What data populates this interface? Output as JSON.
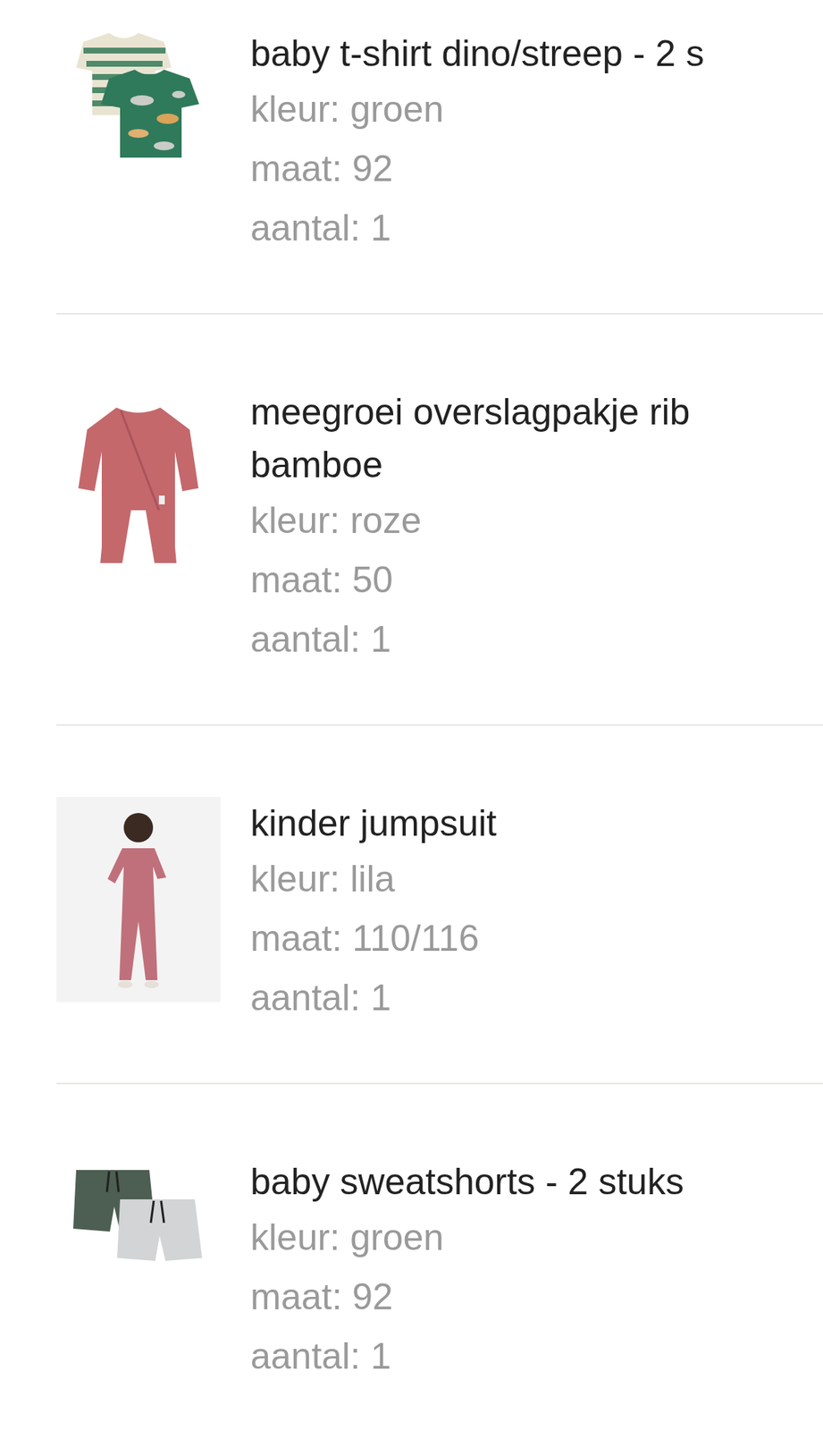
{
  "items": [
    {
      "title": "baby t-shirt dino/streep - 2 s",
      "picture": "tshirts",
      "details": [
        {
          "label": "kleur:",
          "value": "groen"
        },
        {
          "label": "maat:",
          "value": "92"
        },
        {
          "label": "aantal:",
          "value": "1"
        }
      ]
    },
    {
      "title": "meegroei overslagpakje rib bamboe",
      "picture": "onesie",
      "details": [
        {
          "label": "kleur:",
          "value": "roze"
        },
        {
          "label": "maat:",
          "value": "50"
        },
        {
          "label": "aantal:",
          "value": "1"
        }
      ]
    },
    {
      "title": "kinder jumpsuit",
      "picture": "photo",
      "details": [
        {
          "label": "kleur:",
          "value": "lila"
        },
        {
          "label": "maat:",
          "value": "110/116"
        },
        {
          "label": "aantal:",
          "value": "1"
        }
      ]
    },
    {
      "title": "baby sweatshorts - 2 stuks",
      "picture": "shorts",
      "details": [
        {
          "label": "kleur:",
          "value": "groen"
        },
        {
          "label": "maat:",
          "value": "92"
        },
        {
          "label": "aantal:",
          "value": "1"
        }
      ]
    }
  ]
}
